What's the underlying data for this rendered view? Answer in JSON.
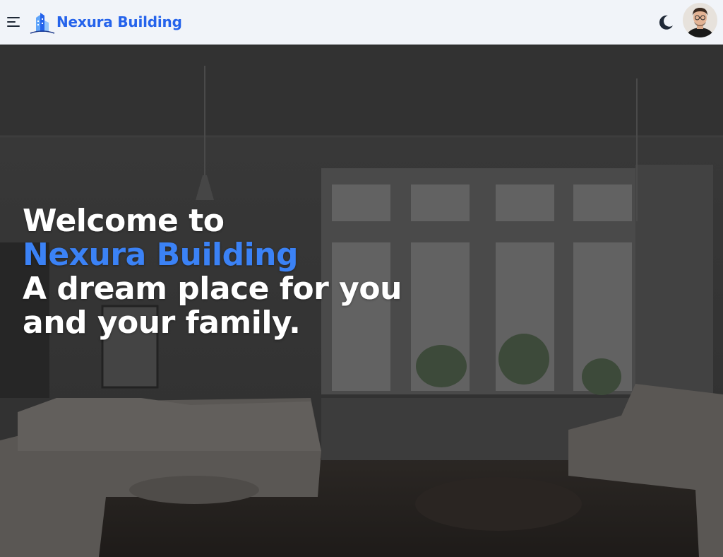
{
  "navbar": {
    "menu_icon": "menu-icon",
    "logo_icon": "building-logo-icon",
    "brand": "Nexura Building",
    "theme_icon": "moon-icon",
    "avatar_icon": "user-avatar"
  },
  "hero": {
    "line1": "Welcome to",
    "line2": "Nexura Building",
    "line3": "A dream place for you",
    "line4": "and your family.",
    "background": "living-room-photo"
  },
  "colors": {
    "accent": "#2563eb",
    "navbar_bg": "#f1f4f9",
    "hero_text": "#ffffff",
    "hero_accent": "#3b82f6"
  }
}
